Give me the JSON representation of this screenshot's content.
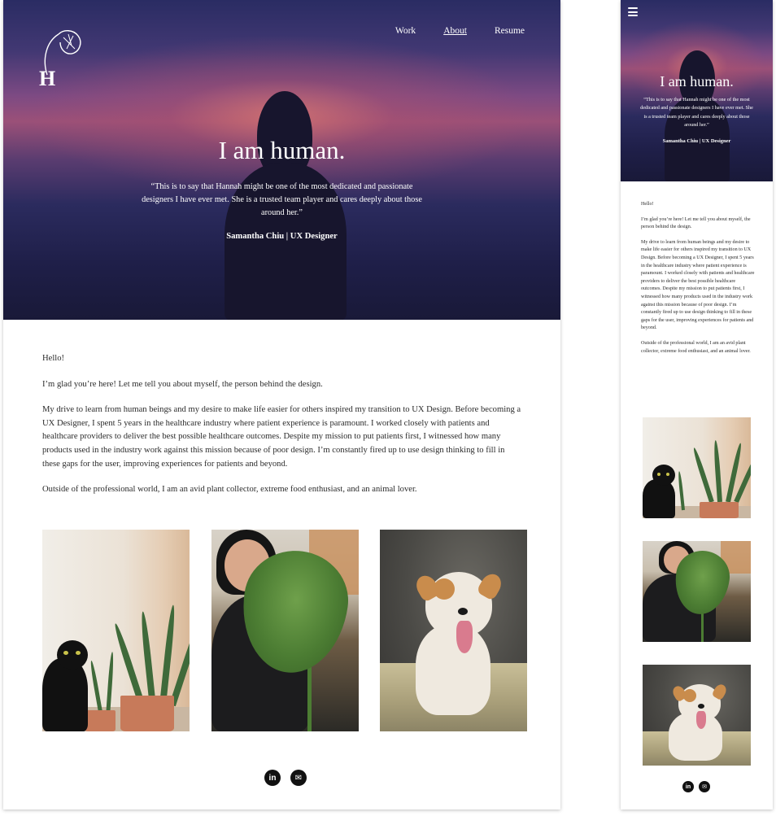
{
  "brand": {
    "logo_letter": "H"
  },
  "nav": {
    "items": [
      "Work",
      "About",
      "Resume"
    ],
    "active": "About"
  },
  "hero": {
    "title": "I am human.",
    "quote": "“This is to say that Hannah might be one of the most dedicated and passionate designers I have ever met. She is a trusted team player and cares deeply about those around her.”",
    "cite": "Samantha Chiu | UX Designer"
  },
  "about": {
    "greeting": "Hello!",
    "intro": "I’m glad you’re here! Let me tell you about myself, the person behind the design.",
    "story": "My drive to learn from human beings and my desire to make life easier for others inspired my transition to UX Design. Before becoming a UX Designer, I spent 5 years in the healthcare industry where patient experience is paramount. I worked closely with patients and healthcare providers to deliver the best possible healthcare outcomes. Despite my mission to put patients first, I witnessed how many products used in the industry work against this mission because of poor design. I’m constantly fired up to use design thinking to fill in these gaps for the user, improving experiences for patients and beyond.",
    "outside": "Outside of the professional world, I am an avid plant collector, extreme food enthusiast, and an animal lover."
  },
  "photos": [
    "cat-with-snake-plant",
    "person-with-monstera-leaf",
    "happy-dog-on-bed"
  ],
  "social": {
    "linkedin_glyph": "in",
    "email_glyph": "✉"
  },
  "icons": [
    "logo-plant-icon",
    "menu-icon",
    "linkedin-icon",
    "email-icon"
  ],
  "colors": {
    "hero_dark": "#1f1f49",
    "hero_glow": "#d67470",
    "text": "#2b2b2b",
    "social": "#111111"
  }
}
